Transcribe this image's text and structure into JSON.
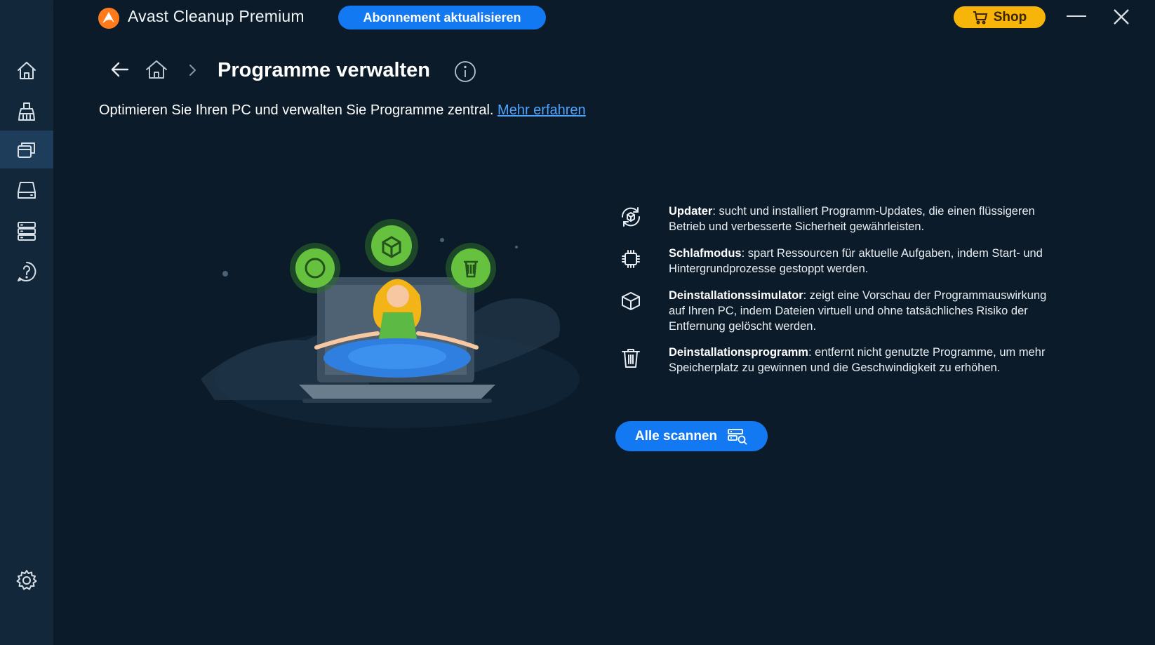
{
  "app": {
    "title": "Avast Cleanup Premium",
    "upgrade_label": "Abonnement aktualisieren",
    "shop_label": "Shop",
    "accent": "#1379f3",
    "shop_color": "#f7b409"
  },
  "sidebar": {
    "items": [
      {
        "icon": "home-icon",
        "active": false
      },
      {
        "icon": "broom-icon",
        "active": false
      },
      {
        "icon": "programs-icon",
        "active": true
      },
      {
        "icon": "drive-icon",
        "active": false
      },
      {
        "icon": "database-icon",
        "active": false
      },
      {
        "icon": "help-icon",
        "active": false
      },
      {
        "icon": "gear-icon",
        "active": false
      }
    ]
  },
  "page": {
    "title": "Programme verwalten",
    "subtitle": "Optimieren Sie Ihren PC und verwalten Sie Programme zentral.",
    "learn_more": "Mehr erfahren"
  },
  "features": [
    {
      "icon": "updater-icon",
      "name": "Updater",
      "text": ": sucht und installiert Programm-Updates, die einen flüssigeren Betrieb und verbesserte Sicherheit gewährleisten."
    },
    {
      "icon": "chip-icon",
      "name": "Schlafmodus",
      "text": ": spart Ressourcen für aktuelle Aufgaben, indem Start- und Hintergrundprozesse gestoppt werden."
    },
    {
      "icon": "box-icon",
      "name": "Deinstallationssimulator",
      "text": ": zeigt eine Vorschau der Programmauswirkung auf Ihren PC, indem Dateien virtuell und ohne tatsächliches Risiko der Entfernung gelöscht werden."
    },
    {
      "icon": "trash-icon",
      "name": "Deinstallationsprogramm",
      "text": ": entfernt nicht genutzte Programme, um mehr Speicherplatz zu gewinnen und die Geschwindigkeit zu erhöhen."
    }
  ],
  "scan_button": {
    "label": "Alle scannen",
    "icon": "scan-icon"
  }
}
